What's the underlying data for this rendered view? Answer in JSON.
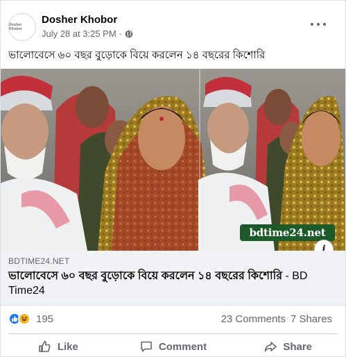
{
  "post": {
    "page_name": "Dosher Khobor",
    "avatar_text": "Dosher Khobor",
    "timestamp": "July 28 at 3:25 PM",
    "separator": "·",
    "text": "ভালোবেসে ৬০ বছর বুড়োকে বিয়ে করলেন ১৪ বছরের কিশোরি"
  },
  "media": {
    "watermark": "bdtime24.net",
    "info_glyph": "i"
  },
  "link": {
    "domain": "BDTIME24.NET",
    "title": "ভালোবেসে ৬০ বছর বুড়োকে বিয়ে করলেন ১৪ বছরের কিশোরি",
    "site_suffix": " - BD Time24"
  },
  "stats": {
    "reaction_count": "195",
    "comments": "23 Comments",
    "shares": "7 Shares"
  },
  "actions": {
    "like": "Like",
    "comment": "Comment",
    "share": "Share"
  },
  "colors": {
    "facebook_blue": "#1877f2",
    "haha_yellow": "#f7b125",
    "secondary_text": "#65676b",
    "link_bg": "#f0f2f5",
    "watermark_green": "#1c5a2a"
  }
}
